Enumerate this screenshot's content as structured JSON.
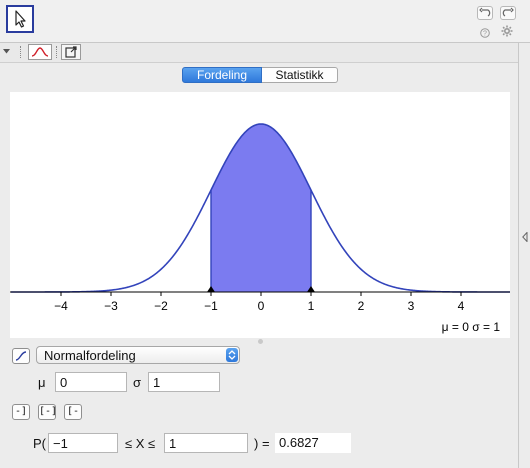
{
  "toolbar": {
    "move_tool": "arrow-cursor-icon",
    "undo": "undo-icon",
    "redo": "redo-icon",
    "help": "help-icon",
    "settings": "gear-icon"
  },
  "tabs": [
    {
      "label": "Fordeling",
      "active": true
    },
    {
      "label": "Statistikk",
      "active": false
    }
  ],
  "chart_data": {
    "type": "area",
    "distribution": "normal",
    "mu": 0,
    "sigma": 1,
    "xlim": [
      -5,
      5
    ],
    "ylim": [
      0,
      0.4
    ],
    "x_ticks": [
      "−4",
      "−3",
      "−2",
      "−1",
      "0",
      "1",
      "2",
      "3",
      "4"
    ],
    "shaded_interval": [
      -1,
      1
    ],
    "marker_points": [
      -1,
      1
    ],
    "params_text": "μ = 0   σ = 1",
    "curve_color": "#3344bb",
    "fill_color": "#7b7bf0"
  },
  "controls": {
    "distribution": "Normalfordeling",
    "mu_label": "μ",
    "mu_value": "0",
    "sigma_label": "σ",
    "sigma_value": "1",
    "prob_open": "P(",
    "low_value": "−1",
    "leq_x_leq": "≤ X ≤",
    "high_value": "1",
    "equals": ") =",
    "result": "0.6827"
  }
}
